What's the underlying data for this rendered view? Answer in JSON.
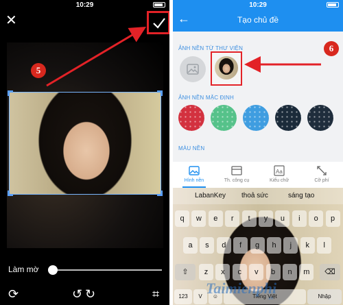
{
  "left": {
    "status_time": "10:29",
    "blur_label": "Làm mờ",
    "blur_level": 0.02,
    "step_badge": "5"
  },
  "right": {
    "status_time": "10:29",
    "title": "Tạo chủ đề",
    "section_library": "ẢNH NỀN TỪ THƯ VIỆN",
    "section_default": "ẢNH NỀN MẶC ĐỊNH",
    "section_color": "MÀU NỀN",
    "step_badge": "6",
    "default_backgrounds": [
      "#d3313f",
      "#56c28a",
      "#3f9de0",
      "#1b2b3a",
      "#1f2d3c"
    ],
    "tabs": [
      {
        "label": "Hình nền",
        "icon": "image-icon"
      },
      {
        "label": "Th. công cụ",
        "icon": "toolbar-icon"
      },
      {
        "label": "Kiểu chữ",
        "icon": "font-icon"
      },
      {
        "label": "Cỡ phí",
        "icon": "resize-icon"
      }
    ],
    "suggestions": [
      "LabanKey",
      "thoả sức",
      "sáng tạo"
    ],
    "row1": [
      "q",
      "w",
      "e",
      "r",
      "t",
      "y",
      "u",
      "i",
      "o",
      "p"
    ],
    "row2": [
      "a",
      "s",
      "d",
      "f",
      "g",
      "h",
      "j",
      "k",
      "l"
    ],
    "row3": [
      "z",
      "x",
      "c",
      "v",
      "b",
      "n",
      "m"
    ],
    "num_key": "123",
    "lang_key": "Tiếng Việt",
    "enter_key": "Nhập",
    "watermark": "Taimienphi",
    "watermark_sub": ".vn"
  },
  "colors": {
    "accent": "#1e8ff0",
    "highlight": "#e32227",
    "badge": "#d8281e"
  }
}
